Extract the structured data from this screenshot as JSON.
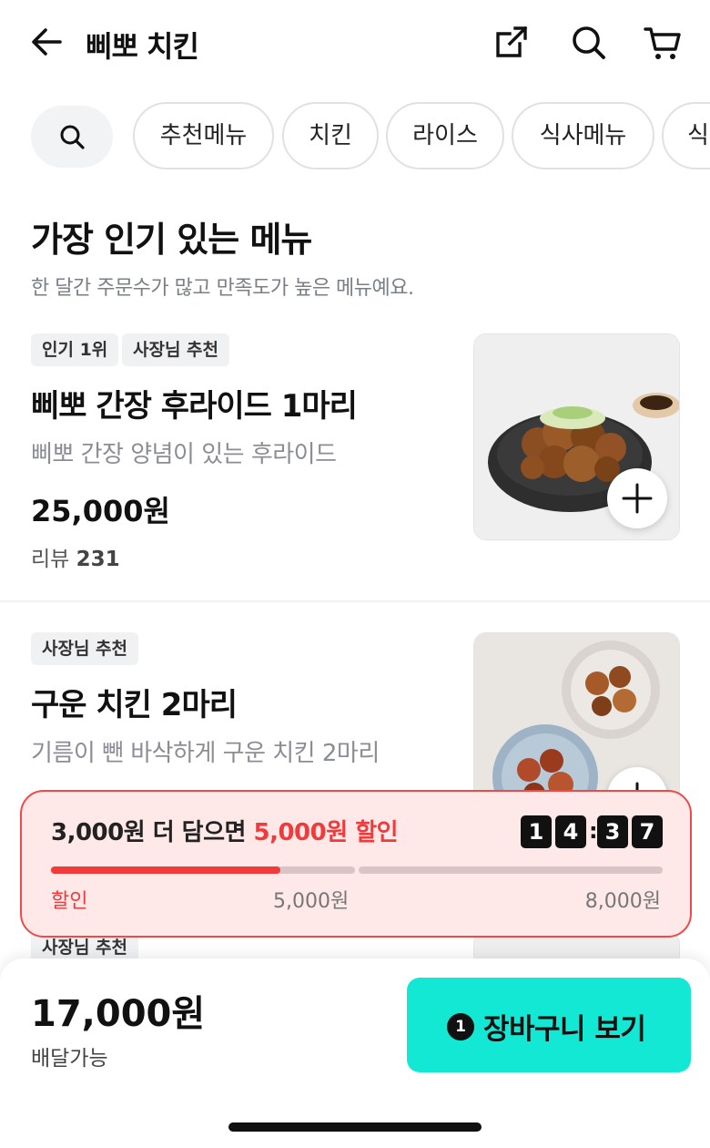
{
  "header": {
    "title": "삐뽀 치킨",
    "icons": [
      "back-arrow-icon",
      "share-icon",
      "search-icon",
      "cart-icon"
    ]
  },
  "chips": [
    "추천메뉴",
    "치킨",
    "라이스",
    "식사메뉴",
    "식"
  ],
  "section": {
    "title": "가장 인기 있는 메뉴",
    "subtitle": "한 달간 주문수가 많고 만족도가 높은 메뉴예요."
  },
  "items": [
    {
      "badges": [
        "인기 1위",
        "사장님 추천"
      ],
      "name": "삐뽀 간장 후라이드 1마리",
      "description": "삐뽀 간장 양념이 있는 후라이드",
      "price": "25,000원",
      "review_label": "리뷰",
      "review_count": "231"
    },
    {
      "badges": [
        "사장님 추천"
      ],
      "name": "구운 치킨 2마리",
      "description": "기름이 뺀 바삭하게 구운 치킨 2마리"
    },
    {
      "badges": [
        "사장님 추천"
      ]
    }
  ],
  "promo": {
    "message_prefix": "3,000원 더 담으면 ",
    "message_highlight": "5,000원 할인",
    "timer_digits": [
      "1",
      "4",
      "3",
      "7"
    ],
    "timer_separator": ":",
    "progress_fraction": 0.375,
    "labels": [
      "할인",
      "5,000원",
      "8,000원"
    ],
    "accent_color": "#ef3b3b"
  },
  "bottom_bar": {
    "total": "17,000원",
    "delivery_status": "배달가능",
    "cart_count": "1",
    "cart_label": "장바구니 보기",
    "button_color": "#12e8d3"
  }
}
